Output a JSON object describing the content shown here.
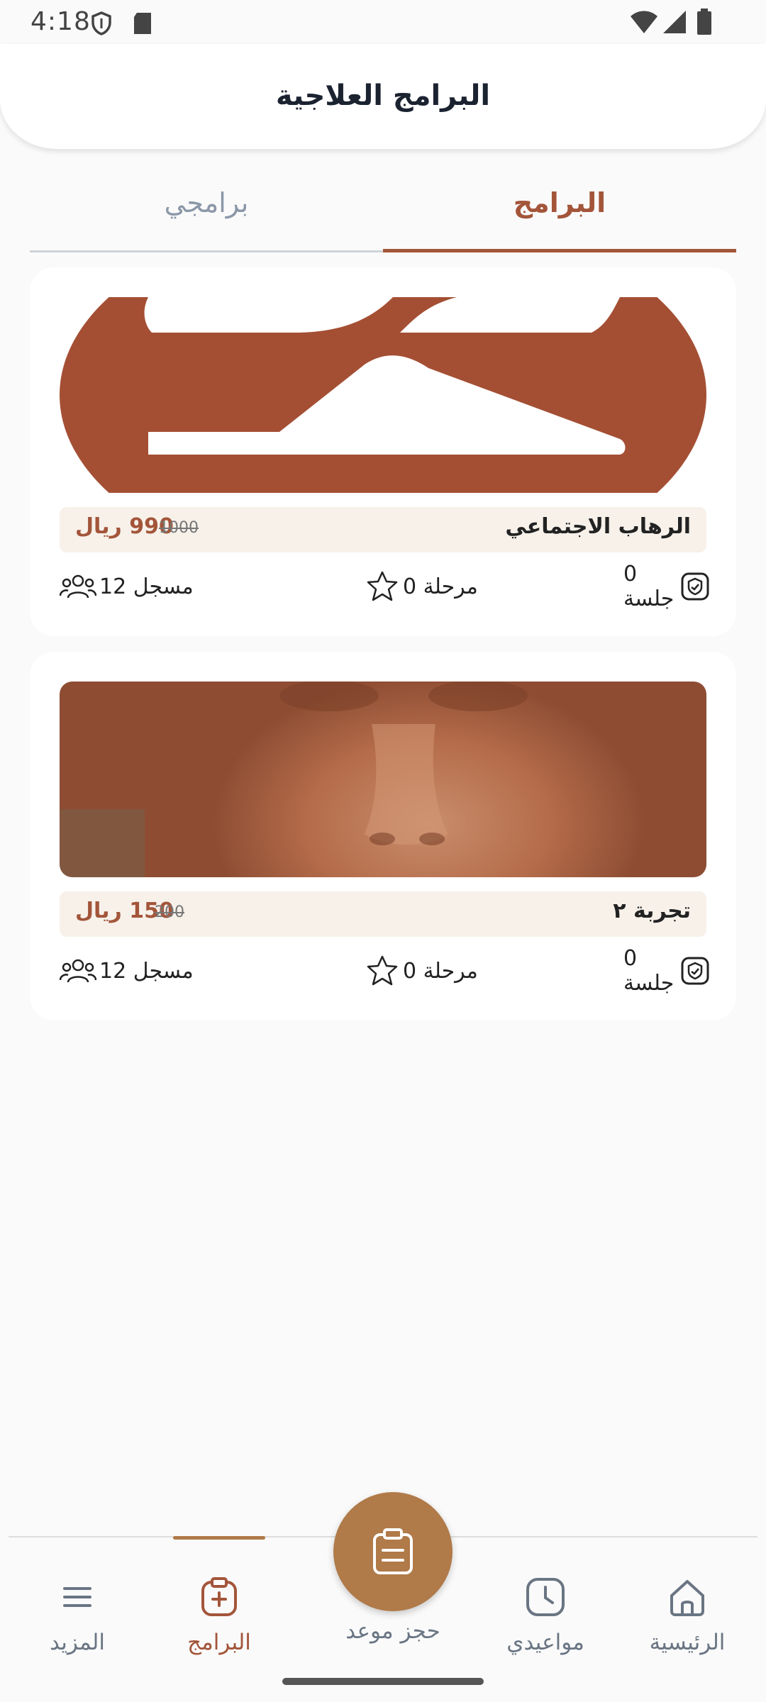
{
  "status_bar": {
    "time": "4:18"
  },
  "header": {
    "title": "البرامج العلاجية"
  },
  "tabs": [
    {
      "label": "البرامج",
      "active": true
    },
    {
      "label": "برامجي",
      "active": false
    }
  ],
  "programs": [
    {
      "name": "الرهاب الاجتماعي",
      "price": "990 ريال",
      "old_price": "1000",
      "sessions": "0 جلسة",
      "stages": "0 مرحلة",
      "enrolled": "12 مسجل",
      "image": "social-phobia-banner"
    },
    {
      "name": "تجربة ٢",
      "price": "150 ريال",
      "old_price": "200",
      "sessions": "0 جلسة",
      "stages": "0 مرحلة",
      "enrolled": "12 مسجل",
      "image": "child-face-photo"
    }
  ],
  "bottom_nav": {
    "home": "الرئيسية",
    "appointments": "مواعيدي",
    "book": "حجز موعد",
    "programs": "البرامج",
    "more": "المزيد"
  },
  "colors": {
    "accent": "#a3553a",
    "fab": "#b07a49",
    "price_bg": "#f7f1ea"
  }
}
